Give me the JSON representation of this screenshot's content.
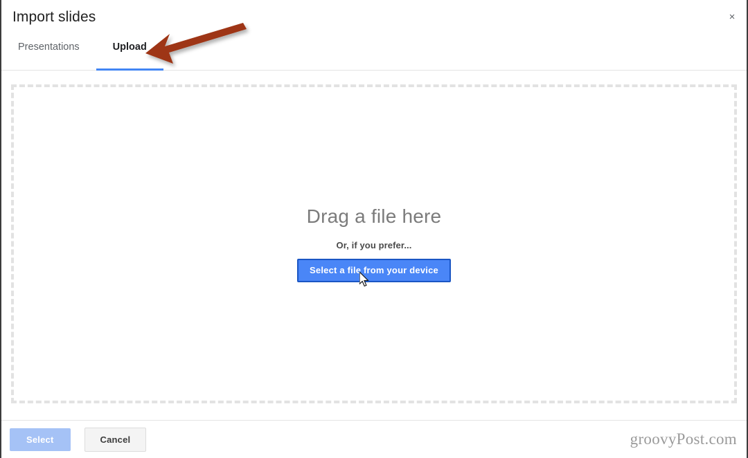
{
  "dialog": {
    "title": "Import slides",
    "close_label": "×"
  },
  "tabs": [
    {
      "label": "Presentations",
      "active": false
    },
    {
      "label": "Upload",
      "active": true
    }
  ],
  "dropzone": {
    "title": "Drag a file here",
    "subtitle": "Or, if you prefer...",
    "button_label": "Select a file from your device"
  },
  "footer": {
    "select_label": "Select",
    "cancel_label": "Cancel",
    "watermark": "groovyPost.com"
  },
  "colors": {
    "accent_blue": "#4285f4",
    "button_blue": "#4a86f7",
    "button_border_blue": "#1a56c4",
    "disabled_blue": "#a5c2f6",
    "dashed_gray": "#e2e2e2",
    "annotation_arrow": "#9e3412",
    "title_text": "#212121",
    "muted_text": "#7b7b7b"
  }
}
